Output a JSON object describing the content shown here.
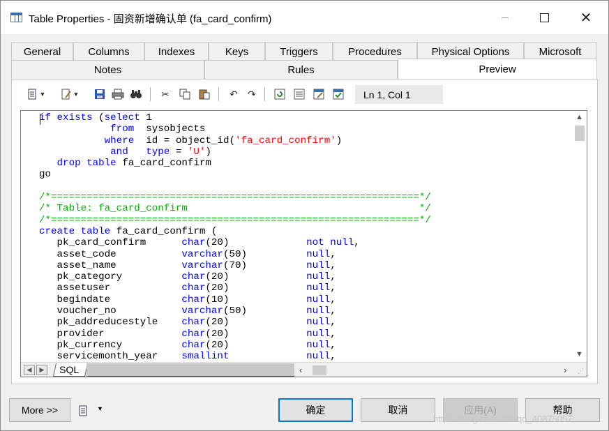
{
  "window": {
    "title": "Table Properties - 固资新增确认单 (fa_card_confirm)"
  },
  "tabs_row1": [
    {
      "label": "General"
    },
    {
      "label": "Columns"
    },
    {
      "label": "Indexes"
    },
    {
      "label": "Keys"
    },
    {
      "label": "Triggers"
    },
    {
      "label": "Procedures"
    },
    {
      "label": "Physical Options"
    },
    {
      "label": "Microsoft"
    }
  ],
  "tabs_row2": [
    {
      "label": "Notes"
    },
    {
      "label": "Rules"
    },
    {
      "label": "Preview",
      "active": true
    }
  ],
  "toolbar": {
    "position_label": "Ln 1, Col 1"
  },
  "editor": {
    "sheet_tab": "SQL"
  },
  "buttons": {
    "more": "More >>",
    "ok": "确定",
    "cancel": "取消",
    "apply": "应用(A)",
    "help": "帮助"
  },
  "watermark": "https://blog.csdn.net/qq_40875057"
}
